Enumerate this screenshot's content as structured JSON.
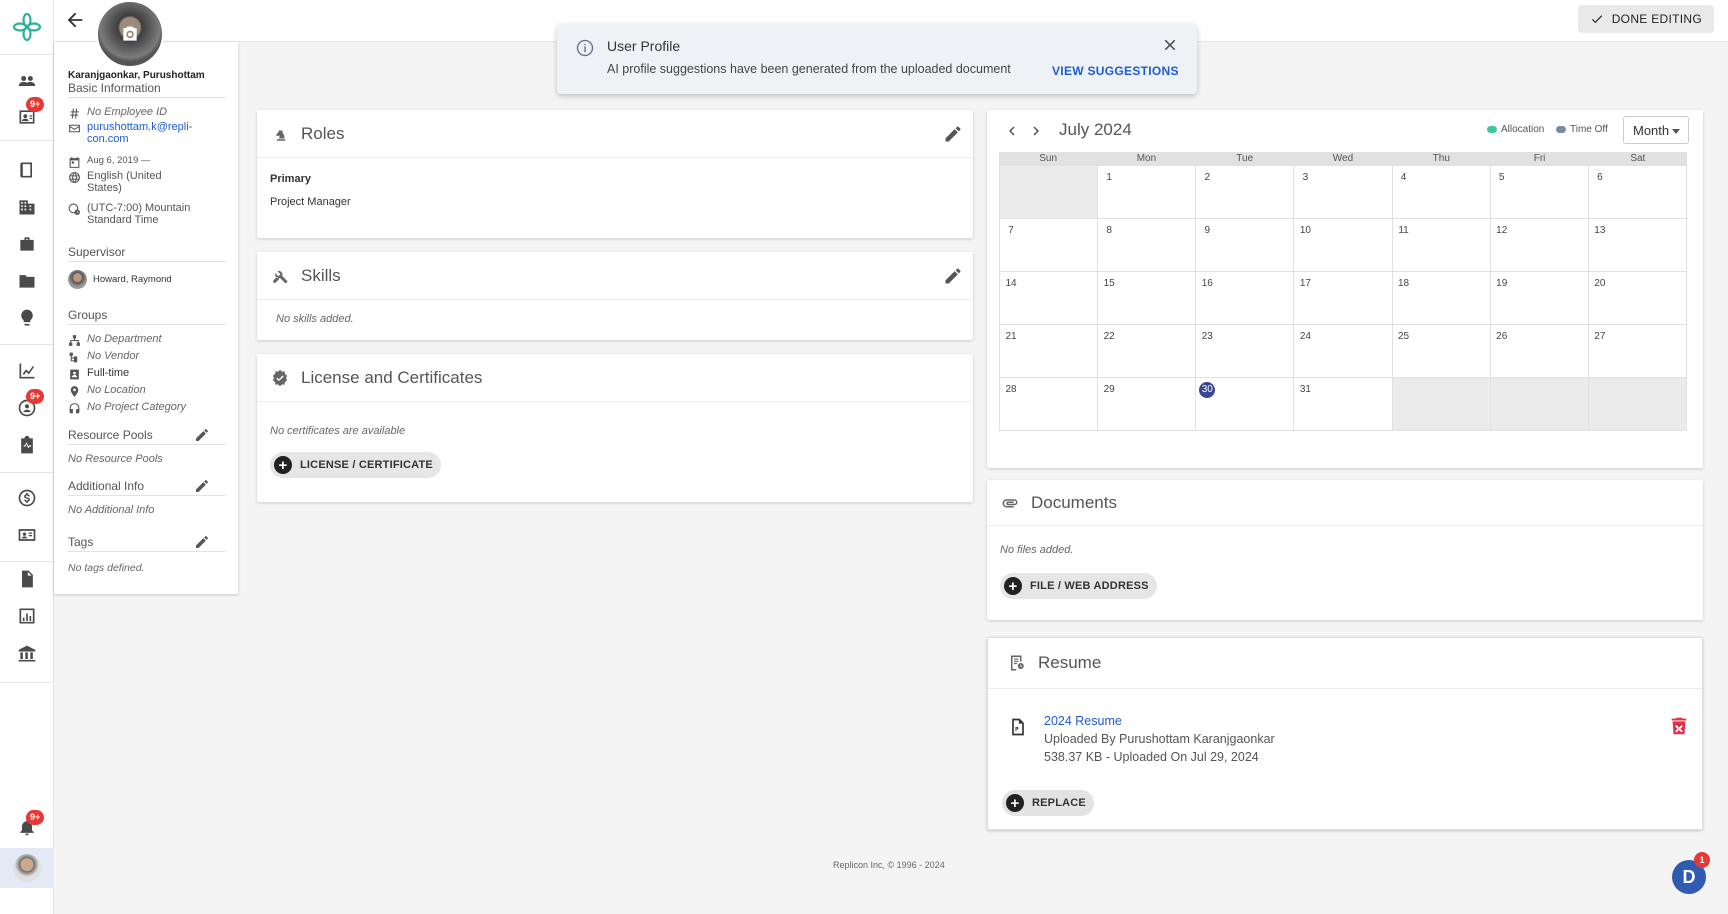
{
  "nav": {
    "badges": [
      "9+",
      "9+",
      "9+"
    ],
    "items": [
      "people-icon",
      "badge-user-icon",
      "book-icon",
      "building-icon",
      "briefcase-icon",
      "folder-icon",
      "lightbulb-icon",
      "chart-edit-icon",
      "heart-user-icon",
      "clipboard-pulse-icon",
      "dollar-icon",
      "contact-book-icon",
      "document-icon",
      "bar-chart-icon",
      "bank-icon",
      "bell-icon"
    ]
  },
  "topbar": {
    "done_label": "DONE EDITING"
  },
  "toast": {
    "title": "User Profile",
    "message": "AI profile suggestions have been generated from the uploaded document",
    "action": "VIEW SUGGESTIONS"
  },
  "profile": {
    "name": "Karanjgaonkar, Purushottam",
    "basic_heading": "Basic Information",
    "employee_id": "No Employee ID",
    "email": "purushottam.k@repli-con.com",
    "start_date": "Aug 6, 2019 —",
    "language": "English (United States)",
    "timezone": "(UTC-7:00) Mountain Standard Time",
    "supervisor_heading": "Supervisor",
    "supervisor": "Howard, Raymond",
    "groups_heading": "Groups",
    "department": "No Department",
    "vendor": "No Vendor",
    "employment": "Full-time",
    "location": "No Location",
    "project_category": "No Project Category",
    "resource_pools_heading": "Resource Pools",
    "resource_pools": "No Resource Pools",
    "additional_heading": "Additional Info",
    "additional": "No Additional Info",
    "tags_heading": "Tags",
    "tags": "No tags defined."
  },
  "roles": {
    "title": "Roles",
    "primary_label": "Primary",
    "primary_value": "Project Manager"
  },
  "skills": {
    "title": "Skills",
    "empty": "No skills added."
  },
  "licenses": {
    "title": "License and Certificates",
    "empty": "No certificates are available",
    "add_label": "LICENSE / CERTIFICATE"
  },
  "calendar": {
    "title": "July 2024",
    "legend_allocation": "Allocation",
    "legend_timeoff": "Time Off",
    "view": "Month",
    "allocation_color": "#3ec99a",
    "timeoff_color": "#7a8aa0",
    "days_of_week": [
      "Sun",
      "Mon",
      "Tue",
      "Wed",
      "Thu",
      "Fri",
      "Sat"
    ],
    "cells": [
      "",
      "1",
      "2",
      "3",
      "4",
      "5",
      "6",
      "7",
      "8",
      "9",
      "10",
      "11",
      "12",
      "13",
      "14",
      "15",
      "16",
      "17",
      "18",
      "19",
      "20",
      "21",
      "22",
      "23",
      "24",
      "25",
      "26",
      "27",
      "28",
      "29",
      "30",
      "31",
      "",
      "",
      ""
    ],
    "today": "30"
  },
  "documents": {
    "title": "Documents",
    "empty": "No files added.",
    "add_label": "FILE / WEB ADDRESS"
  },
  "resume": {
    "title": "Resume",
    "file_name": "2024 Resume",
    "uploaded_by": "Uploaded By Purushottam Karanjgaonkar",
    "meta": "538.37 KB - Uploaded On Jul 29, 2024",
    "replace_label": "REPLACE"
  },
  "footer": {
    "text": "Replicon Inc, © 1996 - 2024"
  },
  "help": {
    "letter": "D",
    "badge": "1"
  }
}
